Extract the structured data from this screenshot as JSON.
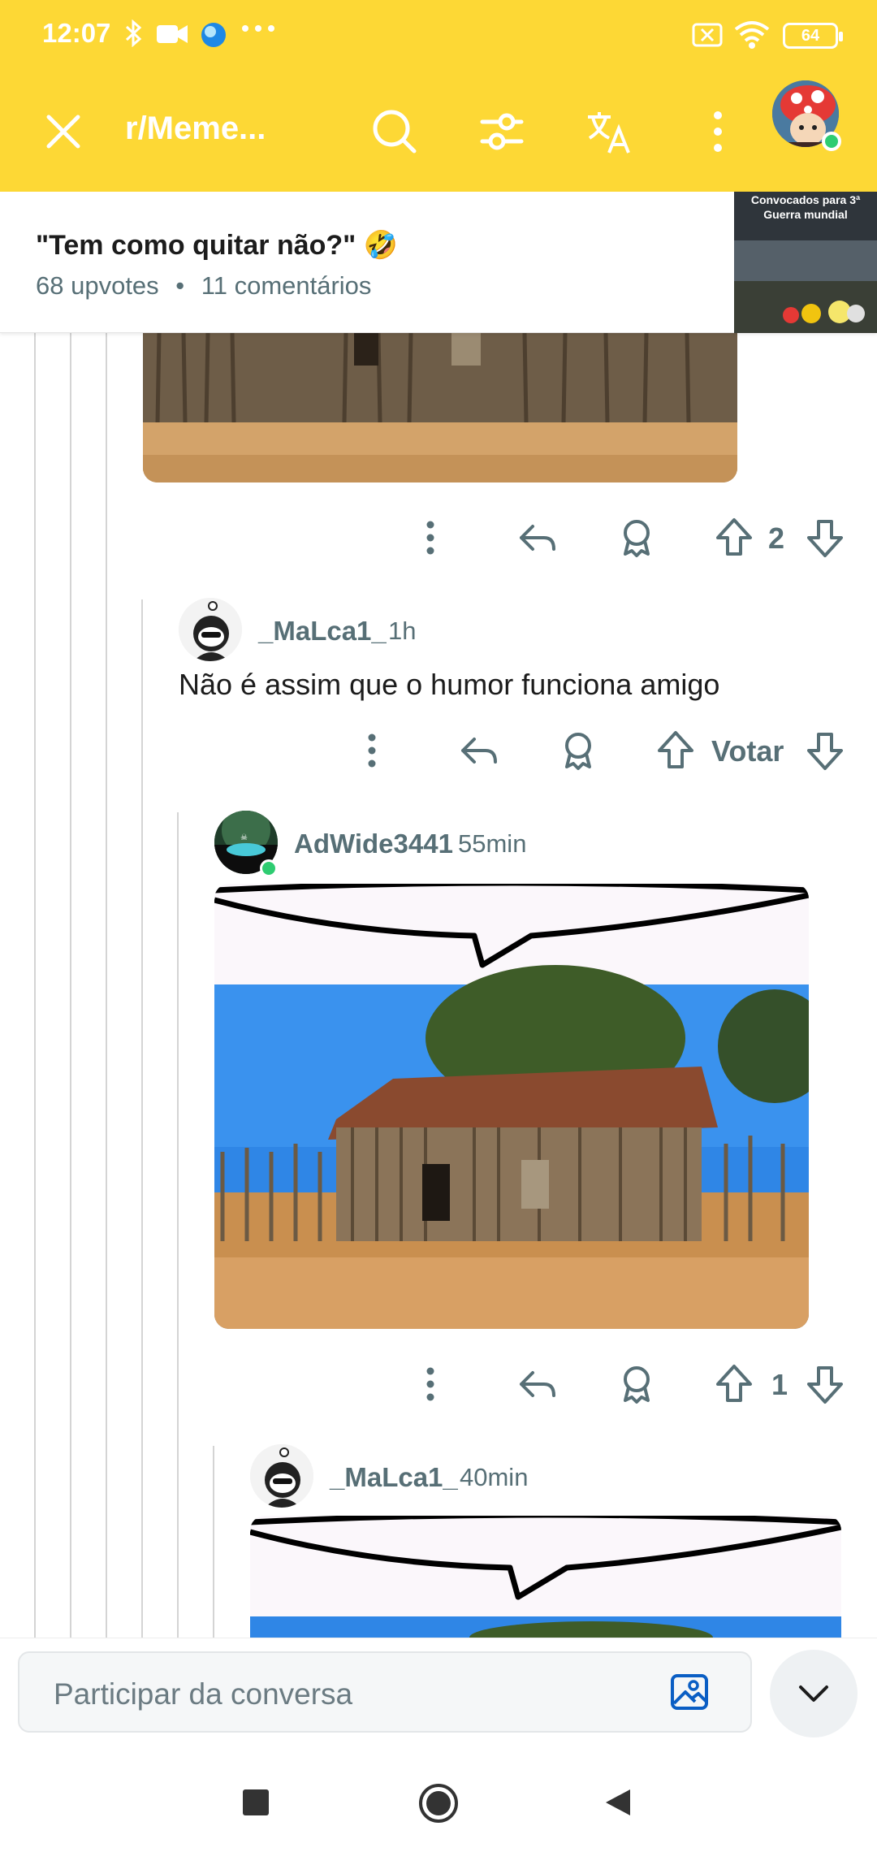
{
  "status_bar": {
    "time": "12:07",
    "battery": "64",
    "icons": [
      "bluetooth-icon",
      "video-icon",
      "app-icon",
      "more-dots-icon",
      "sim-off-icon",
      "wifi-icon",
      "battery-icon"
    ]
  },
  "app_bar": {
    "title": "r/Meme...",
    "icons": [
      "close-icon",
      "search-icon",
      "filter-icon",
      "translate-icon",
      "more-vert-icon"
    ],
    "accent": "#fdd835"
  },
  "post": {
    "title": "\"Tem como quitar não?\"",
    "emoji": "🤣",
    "upvotes": "68 upvotes",
    "separator": "•",
    "comments": "11 comentários",
    "thumb_text_1": "Convocados para 3ª",
    "thumb_text_2": "Guerra mundial"
  },
  "comments": [
    {
      "vote_count": "2"
    },
    {
      "username": "_MaLca1_",
      "time": "1h",
      "text": "Não é assim que o humor funciona amigo",
      "vote_label": "Votar"
    },
    {
      "username": "AdWide3441",
      "time": "55min",
      "vote_count": "1"
    },
    {
      "username": "_MaLca1_",
      "time": "40min"
    }
  ],
  "composer": {
    "placeholder": "Participar da conversa"
  },
  "colors": {
    "meta_text": "#576f76",
    "online": "#2ecc71"
  }
}
